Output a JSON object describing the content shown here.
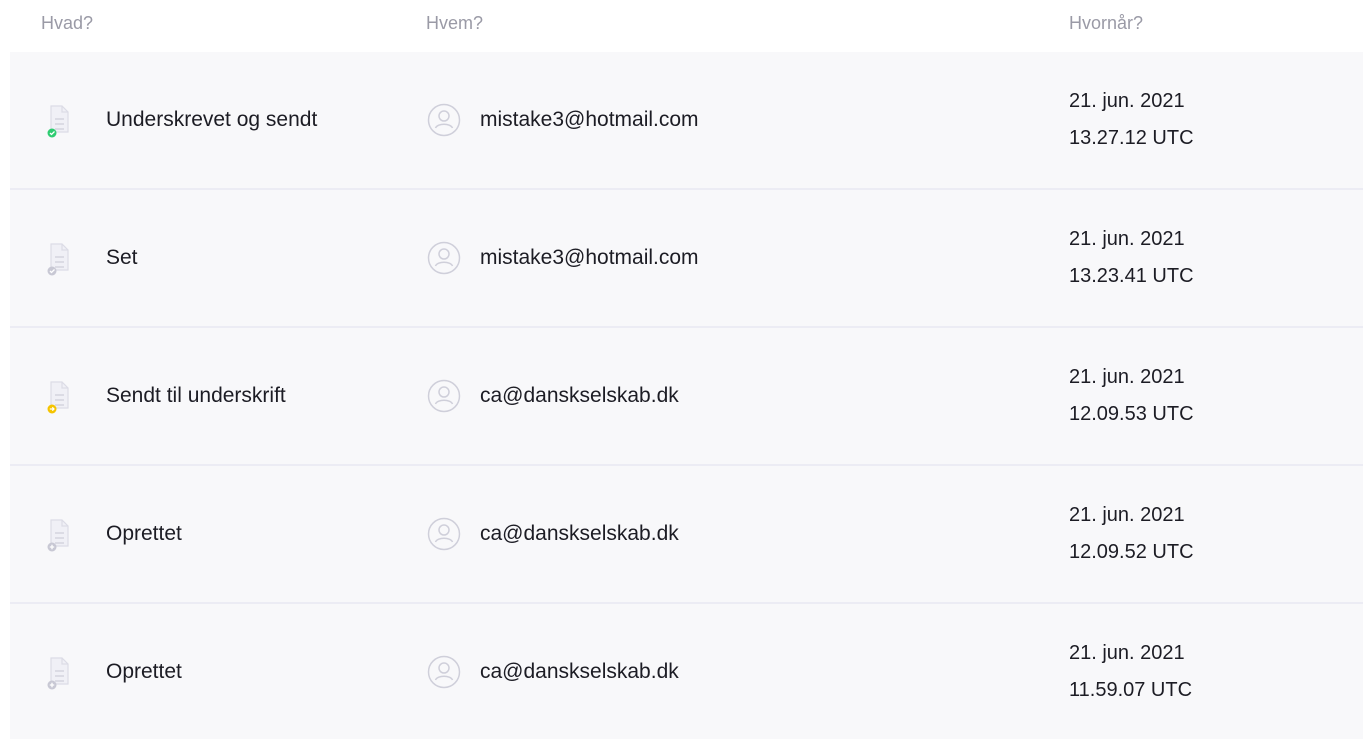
{
  "header": {
    "what": "Hvad?",
    "who": "Hvem?",
    "when": "Hvornår?"
  },
  "events": [
    {
      "status_icon": "document-signed-icon",
      "status_color": "#2ecc71",
      "label": "Underskrevet og sendt",
      "email": "mistake3@hotmail.com",
      "date": "21. jun. 2021",
      "time": "13.27.12 UTC"
    },
    {
      "status_icon": "document-seen-icon",
      "status_color": "#c8c8d4",
      "label": "Set",
      "email": "mistake3@hotmail.com",
      "date": "21. jun. 2021",
      "time": "13.23.41 UTC"
    },
    {
      "status_icon": "document-sent-icon",
      "status_color": "#f5c400",
      "label": "Sendt til underskrift",
      "email": "ca@danskselskab.dk",
      "date": "21. jun. 2021",
      "time": "12.09.53 UTC"
    },
    {
      "status_icon": "document-created-icon",
      "status_color": "#c8c8d4",
      "label": "Oprettet",
      "email": "ca@danskselskab.dk",
      "date": "21. jun. 2021",
      "time": "12.09.52 UTC"
    },
    {
      "status_icon": "document-created-icon",
      "status_color": "#c8c8d4",
      "label": "Oprettet",
      "email": "ca@danskselskab.dk",
      "date": "21. jun. 2021",
      "time": "11.59.07 UTC"
    }
  ]
}
